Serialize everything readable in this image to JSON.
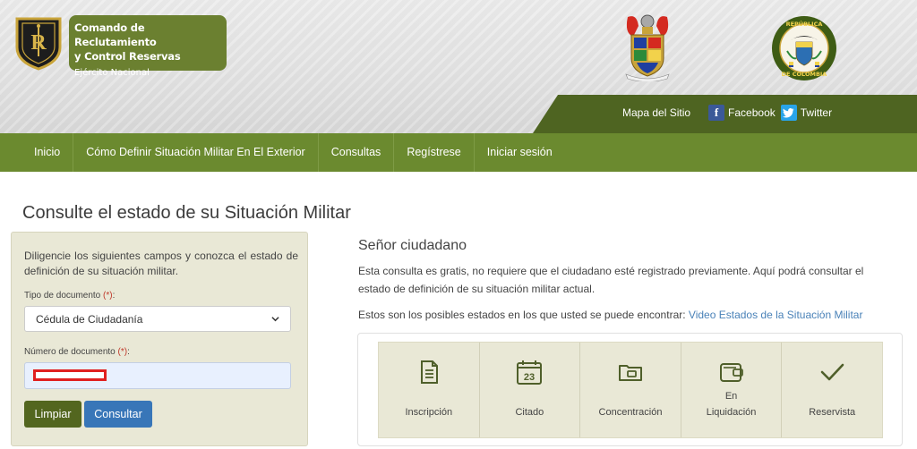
{
  "header": {
    "brand_title_line1": "Comando de Reclutamiento",
    "brand_title_line2": "y Control Reservas",
    "brand_subtitle": "Ejército Nacional",
    "seal_text_top": "REPÚBLICA",
    "seal_text_bottom": "DE COLOMBIA",
    "links": {
      "sitemap": "Mapa del Sitio",
      "facebook": "Facebook",
      "twitter": "Twitter"
    }
  },
  "nav": {
    "items": [
      "Inicio",
      "Cómo Definir Situación Militar En El Exterior",
      "Consultas",
      "Regístrese",
      "Iniciar sesión"
    ]
  },
  "page": {
    "title": "Consulte el estado de su Situación Militar"
  },
  "form": {
    "intro": "Diligencie los siguientes campos y conozca el estado de definición de su situación militar.",
    "doc_type_label": "Tipo de documento",
    "doc_type_value": "Cédula de Ciudadanía",
    "doc_number_label": "Número de documento",
    "required_mark": "(*)",
    "required_suffix": ":",
    "clear_button": "Limpiar",
    "submit_button": "Consultar"
  },
  "info": {
    "greeting": "Señor ciudadano",
    "description": "Esta consulta es gratis, no requiere que el ciudadano esté registrado previamente. Aquí podrá consultar el estado de definición de su situación militar actual.",
    "states_intro": "Estos son los posibles estados en los que usted se puede encontrar:",
    "states_video_link": "Video Estados de la Situación Militar"
  },
  "states": [
    {
      "label": "Inscripción",
      "icon": "document-icon"
    },
    {
      "label": "Citado",
      "icon": "calendar-icon",
      "icon_text": "23"
    },
    {
      "label": "Concentración",
      "icon": "folder-icon"
    },
    {
      "label": "En Liquidación",
      "icon": "wallet-icon"
    },
    {
      "label": "Reservista",
      "icon": "checkmark-icon"
    }
  ],
  "colors": {
    "brand_green": "#6b8030",
    "nav_green": "#6b8a2f",
    "topbar_green": "#4e6421",
    "panel_beige": "#e9e8d6",
    "link_blue": "#4a82b8",
    "submit_blue": "#3876b8"
  }
}
